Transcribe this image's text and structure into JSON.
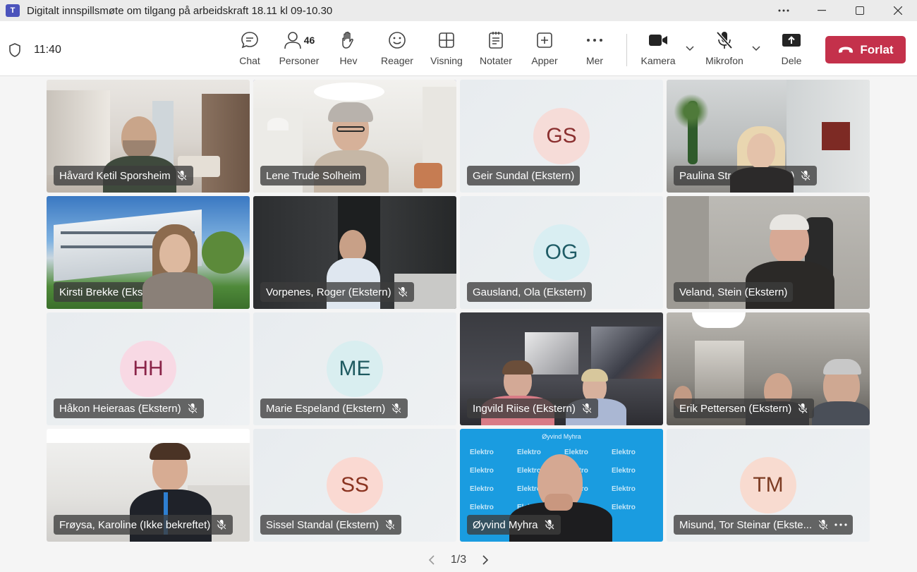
{
  "window": {
    "title": "Digitalt innspillsmøte om tilgang på arbeidskraft 18.11 kl 09-10.30",
    "app_logo": "T"
  },
  "toolbar": {
    "time": "11:40",
    "chat_label": "Chat",
    "people_label": "Personer",
    "people_count": "46",
    "raise_label": "Hev",
    "react_label": "Reager",
    "view_label": "Visning",
    "notes_label": "Notater",
    "apps_label": "Apper",
    "more_label": "Mer",
    "camera_label": "Kamera",
    "mic_label": "Mikrofon",
    "share_label": "Dele",
    "leave_label": "Forlat"
  },
  "participants": [
    {
      "name": "Håvard Ketil Sporsheim",
      "muted": true
    },
    {
      "name": "Lene Trude Solheim",
      "muted": false,
      "selected": true
    },
    {
      "name": "Geir Sundal (Ekstern)",
      "muted": false,
      "initials": "GS"
    },
    {
      "name": "Paulina Strand (Ekstern)",
      "muted": true
    },
    {
      "name": "Kirsti Brekke (Ekstern)",
      "muted": true
    },
    {
      "name": "Vorpenes, Roger (Ekstern)",
      "muted": true
    },
    {
      "name": "Gausland, Ola (Ekstern)",
      "muted": false,
      "initials": "OG"
    },
    {
      "name": "Veland, Stein (Ekstern)",
      "muted": false
    },
    {
      "name": "Håkon Heieraas (Ekstern)",
      "muted": true,
      "initials": "HH"
    },
    {
      "name": "Marie Espeland (Ekstern)",
      "muted": true,
      "initials": "ME"
    },
    {
      "name": "Ingvild Riise (Ekstern)",
      "muted": true
    },
    {
      "name": "Erik Pettersen (Ekstern)",
      "muted": true
    },
    {
      "name": "Frøysa, Karoline (Ikke bekreftet)",
      "muted": true
    },
    {
      "name": "Sissel Standal (Ekstern)",
      "muted": true,
      "initials": "SS"
    },
    {
      "name": "Øyvind Myhra",
      "muted": true,
      "banner_text": "Øyvind Myhra",
      "brand": "Elektro"
    },
    {
      "name": "Misund, Tor Steinar (Ekste...",
      "muted": true,
      "initials": "TM"
    }
  ],
  "pager": {
    "text": "1/3"
  },
  "colors": {
    "accent": "#5b5fc7",
    "leave": "#c4314b",
    "avatar_gs_bg": "#f6dcd8",
    "avatar_gs_fg": "#8a2f2f",
    "avatar_og_bg": "#d9eef2",
    "avatar_og_fg": "#1f5c66",
    "avatar_hh_bg": "#f8d9e4",
    "avatar_hh_fg": "#8a2448",
    "avatar_me_bg": "#d9eef0",
    "avatar_me_fg": "#1e5a60",
    "avatar_ss_bg": "#fad9d2",
    "avatar_ss_fg": "#8a3320",
    "avatar_tm_bg": "#f8dbd0",
    "avatar_tm_fg": "#7c3b22"
  }
}
